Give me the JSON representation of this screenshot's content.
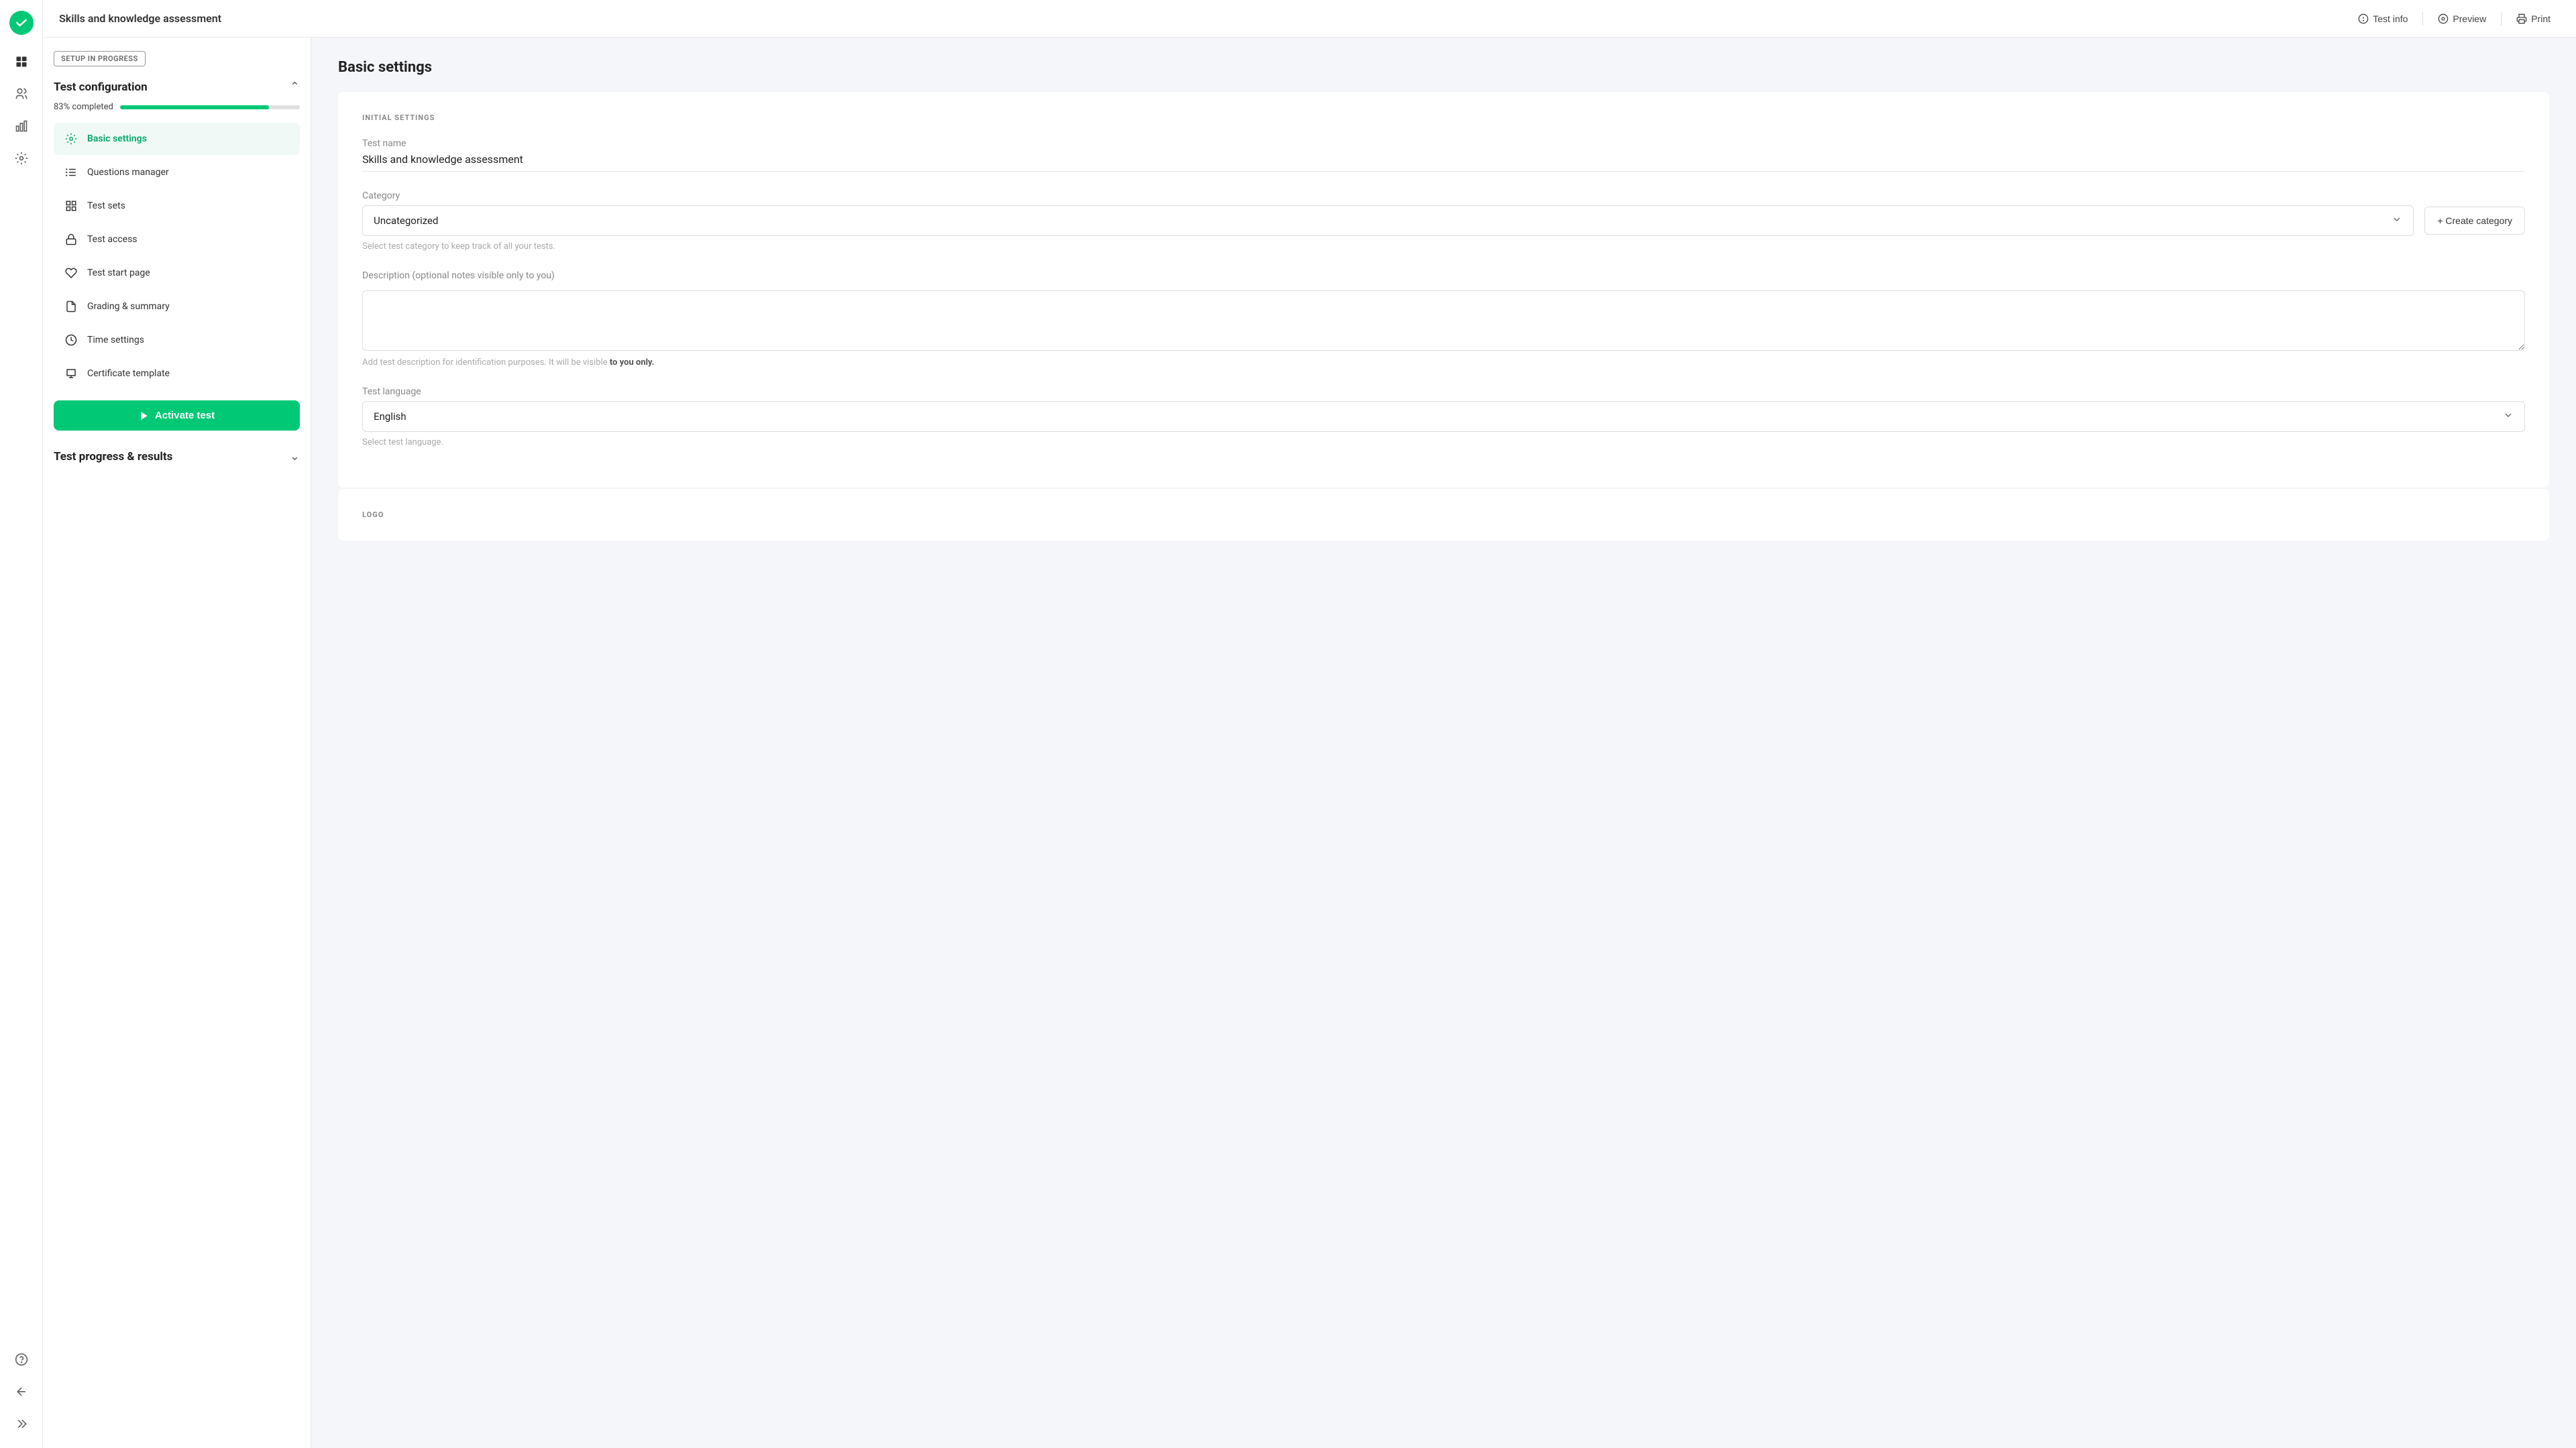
{
  "header": {
    "page_title": "Skills and knowledge assessment",
    "test_info_label": "Test info",
    "preview_label": "Preview",
    "print_label": "Print"
  },
  "sidebar_nav": {
    "items": [
      {
        "name": "dashboard",
        "icon": "⊞"
      },
      {
        "name": "users",
        "icon": "👥"
      },
      {
        "name": "analytics",
        "icon": "📊"
      },
      {
        "name": "settings",
        "icon": "⚙"
      }
    ],
    "bottom_items": [
      {
        "name": "help",
        "icon": "?"
      },
      {
        "name": "back",
        "icon": "←"
      },
      {
        "name": "collapse",
        "icon": "»"
      }
    ]
  },
  "left_panel": {
    "setup_badge": "SETUP IN PROGRESS",
    "test_configuration": {
      "title": "Test configuration",
      "progress_label": "83% completed",
      "progress_percent": 83,
      "menu_items": [
        {
          "id": "basic-settings",
          "label": "Basic settings",
          "active": true
        },
        {
          "id": "questions-manager",
          "label": "Questions manager",
          "active": false
        },
        {
          "id": "test-sets",
          "label": "Test sets",
          "active": false
        },
        {
          "id": "test-access",
          "label": "Test access",
          "active": false
        },
        {
          "id": "test-start-page",
          "label": "Test start page",
          "active": false
        },
        {
          "id": "grading-summary",
          "label": "Grading & summary",
          "active": false
        },
        {
          "id": "time-settings",
          "label": "Time settings",
          "active": false
        },
        {
          "id": "certificate-template",
          "label": "Certificate template",
          "active": false
        }
      ],
      "activate_btn": "Activate test"
    },
    "test_progress": {
      "title": "Test progress & results"
    }
  },
  "main": {
    "section_title": "Basic settings",
    "initial_settings_label": "INITIAL SETTINGS",
    "test_name": {
      "label": "Test name",
      "value": "Skills and knowledge assessment"
    },
    "category": {
      "label": "Category",
      "value": "Uncategorized",
      "helper_text": "Select test category to keep track of all your tests.",
      "create_label": "+ Create category"
    },
    "description": {
      "label": "Description (optional notes visible only to you)",
      "placeholder": "",
      "helper_text_prefix": "Add test description for identification purposes. It will be visible ",
      "helper_bold": "to you only.",
      "helper_suffix": ""
    },
    "language": {
      "label": "Test language",
      "value": "English",
      "helper_text": "Select test language."
    },
    "logo_section_label": "LOGO"
  }
}
